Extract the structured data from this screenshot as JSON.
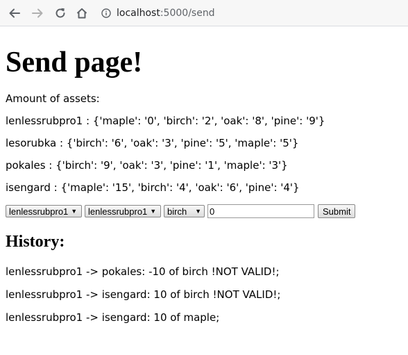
{
  "browser": {
    "url_host": "localhost",
    "url_path": ":5000/send"
  },
  "page": {
    "title": "Send page!",
    "amount_label": "Amount of assets:",
    "assets": [
      "lenlessrubpro1 : {'maple': '0', 'birch': '2', 'oak': '8', 'pine': '9'}",
      "lesorubka : {'birch': '6', 'oak': '3', 'pine': '5', 'maple': '5'}",
      "pokales : {'birch': '9', 'oak': '3', 'pine': '1', 'maple': '3'}",
      "isengard : {'maple': '15', 'birch': '4', 'oak': '6', 'pine': '4'}"
    ],
    "form": {
      "from_select": "lenlessrubpro1",
      "to_select": "lenlessrubpro1",
      "asset_select": "birch",
      "amount_value": "0",
      "submit_label": "Submit"
    },
    "history_title": "History:",
    "history": [
      "lenlessrubpro1 -> pokales: -10 of birch !NOT VALID!;",
      "lenlessrubpro1 -> isengard: 10 of birch !NOT VALID!;",
      "lenlessrubpro1 -> isengard: 10 of maple;"
    ]
  }
}
